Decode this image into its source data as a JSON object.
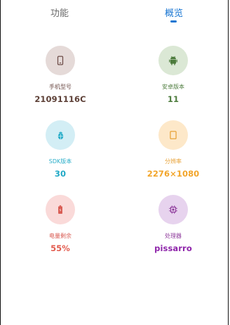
{
  "tabs": {
    "left_label": "功能",
    "right_label": "概览"
  },
  "items": [
    {
      "label": "手机型号",
      "value": "21091116C",
      "icon": "phone-icon",
      "circle_color": "#e5dad8",
      "icon_color": "#6d4c47",
      "label_color": "#6d4c47",
      "value_color": "#5d4037"
    },
    {
      "label": "安卓版本",
      "value": "11",
      "icon": "android-icon",
      "circle_color": "#dbe8d5",
      "icon_color": "#4c7b3c",
      "label_color": "#4c7b3c",
      "value_color": "#4c7b3c"
    },
    {
      "label": "SDK版本",
      "value": "30",
      "icon": "bug-icon",
      "circle_color": "#d3eef5",
      "icon_color": "#2aaec9",
      "label_color": "#2aaec9",
      "value_color": "#21a9c6"
    },
    {
      "label": "分辨率",
      "value": "2276×1080",
      "icon": "screen-icon",
      "circle_color": "#fde8c9",
      "icon_color": "#e8a33a",
      "label_color": "#e8a33a",
      "value_color": "#f2a52a"
    },
    {
      "label": "电量剩余",
      "value": "55%",
      "icon": "battery-icon",
      "circle_color": "#fadad9",
      "icon_color": "#d85950",
      "label_color": "#d85950",
      "value_color": "#e25b4e"
    },
    {
      "label": "处理器",
      "value": "pissarro",
      "icon": "chip-icon",
      "circle_color": "#e7d3ee",
      "icon_color": "#8e3a9b",
      "label_color": "#8e3a9b",
      "value_color": "#8e24aa"
    }
  ]
}
